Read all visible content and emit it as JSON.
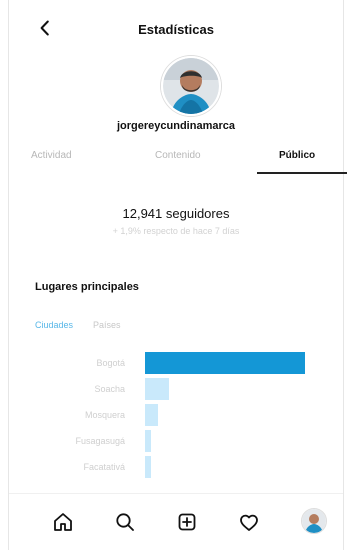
{
  "header": {
    "title": "Estadísticas"
  },
  "profile": {
    "username": "jorgereycundinamarca"
  },
  "tabs": [
    {
      "label": "Actividad",
      "active": false
    },
    {
      "label": "Contenido",
      "active": false
    },
    {
      "label": "Público",
      "active": true
    }
  ],
  "audience": {
    "followers_text": "12,941 seguidores",
    "subtext": "+ 1,9% respecto de hace 7 días"
  },
  "top_locations": {
    "title": "Lugares principales",
    "filters": [
      {
        "label": "Ciudades",
        "active": true
      },
      {
        "label": "Países",
        "active": false
      }
    ]
  },
  "chart_data": {
    "type": "bar",
    "orientation": "horizontal",
    "categories": [
      "Bogotá",
      "Soacha",
      "Mosquera",
      "Fusagasugá",
      "Facatativá"
    ],
    "values": [
      100,
      15,
      8,
      2,
      2
    ],
    "xlim": [
      0,
      100
    ],
    "grid": false,
    "colors": {
      "primary": "#1497d6",
      "secondary": "#c9e9fb"
    }
  },
  "bottom_nav": [
    {
      "name": "home"
    },
    {
      "name": "search"
    },
    {
      "name": "create"
    },
    {
      "name": "activity"
    },
    {
      "name": "profile"
    }
  ]
}
